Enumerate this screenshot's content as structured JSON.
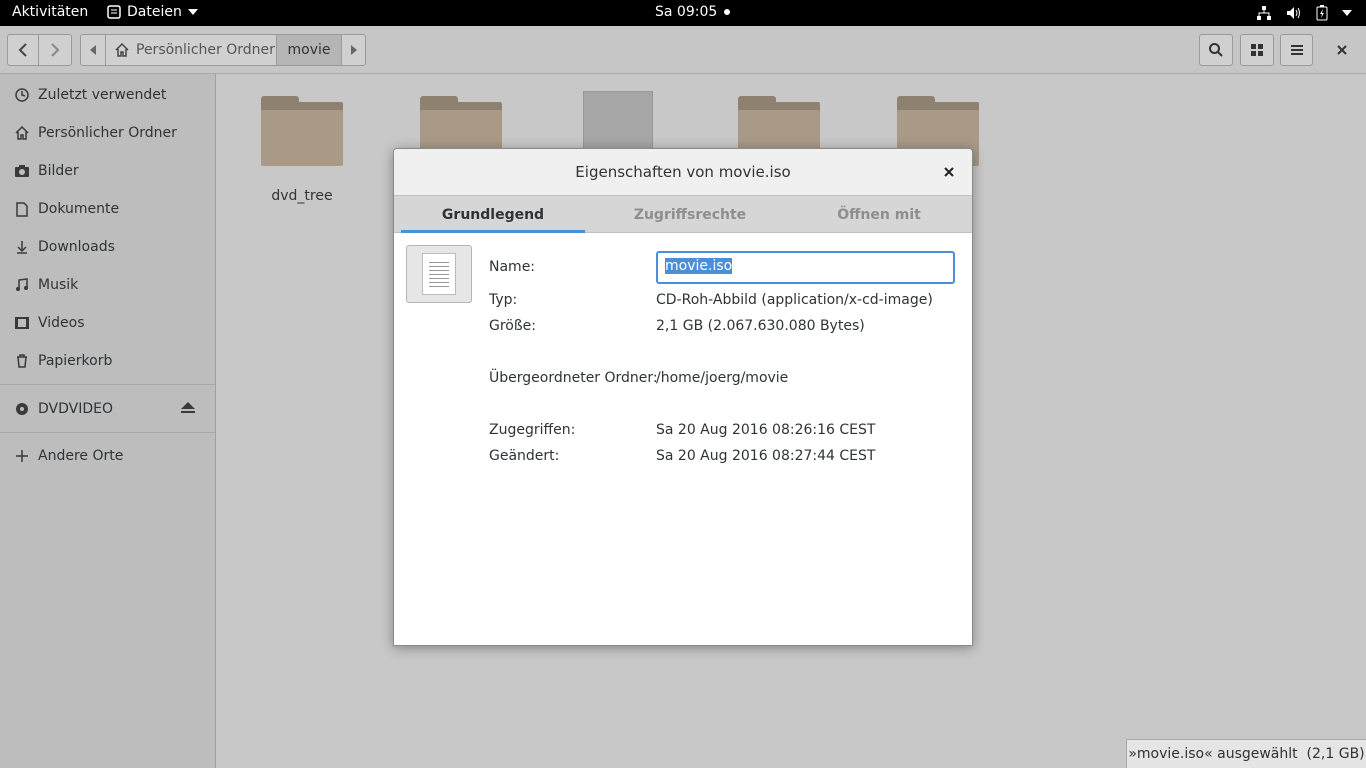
{
  "topbar": {
    "activities": "Aktivitäten",
    "app_menu": "Dateien",
    "clock": "Sa 09:05"
  },
  "headerbar": {
    "breadcrumbs": [
      "Persönlicher Ordner",
      "movie"
    ]
  },
  "sidebar": {
    "items": [
      {
        "label": "Zuletzt verwendet",
        "icon": "clock-icon"
      },
      {
        "label": "Persönlicher Ordner",
        "icon": "home-icon"
      },
      {
        "label": "Bilder",
        "icon": "camera-icon"
      },
      {
        "label": "Dokumente",
        "icon": "document-icon"
      },
      {
        "label": "Downloads",
        "icon": "download-icon"
      },
      {
        "label": "Musik",
        "icon": "music-icon"
      },
      {
        "label": "Videos",
        "icon": "film-icon"
      },
      {
        "label": "Papierkorb",
        "icon": "trash-icon"
      }
    ],
    "device": {
      "label": "DVDVIDEO",
      "icon": "disc-icon"
    },
    "other": {
      "label": "Andere Orte",
      "icon": "plus-icon"
    }
  },
  "files": {
    "items": [
      {
        "label": "dvd_tree",
        "type": "folder"
      },
      {
        "label": "",
        "type": "folder"
      },
      {
        "label": "",
        "type": "document"
      },
      {
        "label": "",
        "type": "folder"
      },
      {
        "label": "",
        "type": "folder"
      }
    ]
  },
  "dialog": {
    "title": "Eigenschaften von movie.iso",
    "tabs": [
      "Grundlegend",
      "Zugriffsrechte",
      "Öffnen mit"
    ],
    "name_label": "Name:",
    "name_value": "movie.iso",
    "type_label": "Typ:",
    "type_value": "CD-Roh-Abbild (application/x-cd-image)",
    "size_label": "Größe:",
    "size_value": "2,1 GB (2.067.630.080 Bytes)",
    "parent_label": "Übergeordneter Ordner:",
    "parent_value": "/home/joerg/movie",
    "accessed_label": "Zugegriffen:",
    "accessed_value": "Sa 20 Aug 2016 08:26:16 CEST",
    "modified_label": "Geändert:",
    "modified_value": "Sa 20 Aug 2016 08:27:44 CEST"
  },
  "status": {
    "text": "»movie.iso« ausgewählt  (2,1 GB)"
  },
  "colors": {
    "accent": "#4a90d9",
    "folder": "#a99a87"
  }
}
